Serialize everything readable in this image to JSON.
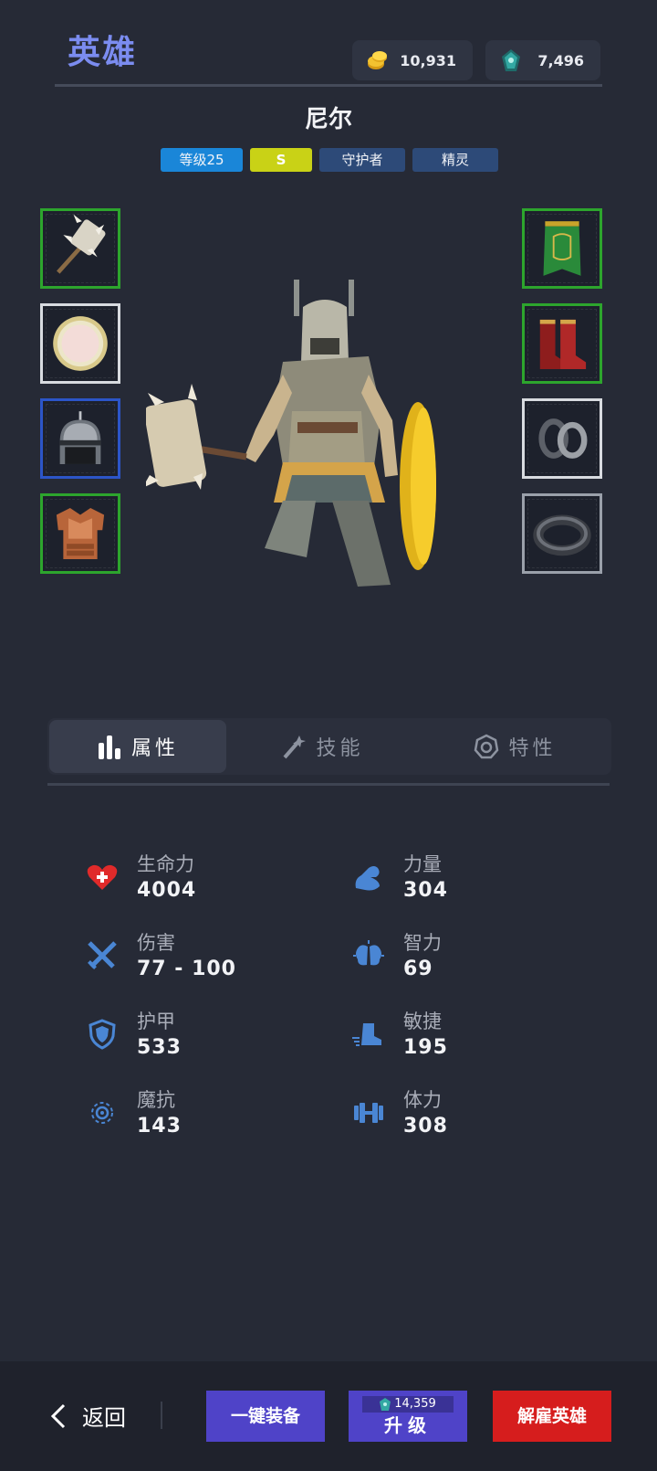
{
  "header": {
    "title": "英雄",
    "gold": "10,931",
    "gems": "7,496"
  },
  "hero": {
    "name": "尼尔",
    "tags": {
      "level": "等级25",
      "grade": "S",
      "class": "守护者",
      "race": "精灵"
    }
  },
  "equipment": {
    "left": [
      "spiked-hammer-icon",
      "round-shield-icon",
      "helmet-icon",
      "chest-armor-icon"
    ],
    "right": [
      "green-cape-icon",
      "red-boots-icon",
      "ring-icon",
      "bracelet-icon"
    ]
  },
  "tabs": [
    {
      "label": "属性",
      "icon": "bar-chart-icon",
      "active": true
    },
    {
      "label": "技能",
      "icon": "magic-wand-icon",
      "active": false
    },
    {
      "label": "特性",
      "icon": "trait-icon",
      "active": false
    }
  ],
  "stats": {
    "hp": {
      "label": "生命力",
      "value": "4004"
    },
    "strength": {
      "label": "力量",
      "value": "304"
    },
    "damage": {
      "label": "伤害",
      "value": "77 - 100"
    },
    "intellect": {
      "label": "智力",
      "value": "69"
    },
    "armor": {
      "label": "护甲",
      "value": "533"
    },
    "agility": {
      "label": "敏捷",
      "value": "195"
    },
    "magic_resist": {
      "label": "魔抗",
      "value": "143"
    },
    "stamina": {
      "label": "体力",
      "value": "308"
    }
  },
  "bottom": {
    "back_label": "返回",
    "equip_all_label": "一键装备",
    "upgrade_cost": "14,359",
    "upgrade_label": "升级",
    "dismiss_label": "解雇英雄"
  },
  "colors": {
    "accent": "#7b8cf0",
    "button_primary": "#4f43c8",
    "button_danger": "#d61d1d",
    "slot_green": "#2da52d"
  }
}
